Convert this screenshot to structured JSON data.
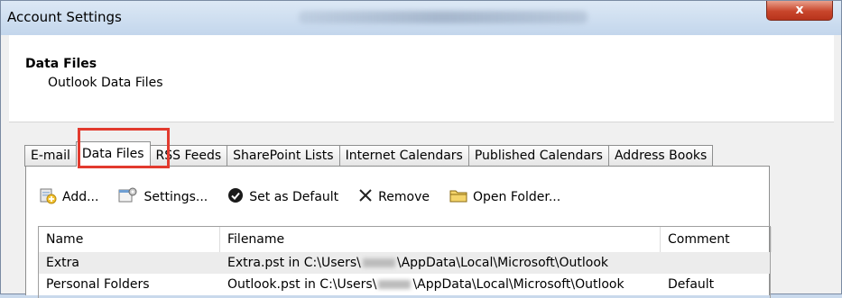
{
  "window": {
    "title": "Account Settings",
    "close_label": "x"
  },
  "header": {
    "title": "Data Files",
    "subtitle": "Outlook Data Files"
  },
  "tabs": [
    {
      "label": "E-mail"
    },
    {
      "label": "Data Files",
      "active": true
    },
    {
      "label": "RSS Feeds"
    },
    {
      "label": "SharePoint Lists"
    },
    {
      "label": "Internet Calendars"
    },
    {
      "label": "Published Calendars"
    },
    {
      "label": "Address Books"
    }
  ],
  "toolbar": {
    "add_label": "Add...",
    "settings_label": "Settings...",
    "set_default_label": "Set as Default",
    "remove_label": "Remove",
    "open_folder_label": "Open Folder..."
  },
  "list": {
    "columns": {
      "name": "Name",
      "filename": "Filename",
      "comment": "Comment"
    },
    "rows": [
      {
        "name": "Extra",
        "filename_prefix": "Extra.pst in C:\\Users\\",
        "filename_suffix": "\\AppData\\Local\\Microsoft\\Outlook",
        "comment": ""
      },
      {
        "name": "Personal Folders",
        "filename_prefix": "Outlook.pst in C:\\Users\\",
        "filename_suffix": "\\AppData\\Local\\Microsoft\\Outlook",
        "comment": "Default"
      }
    ]
  },
  "colors": {
    "highlight": "#e23a2e",
    "close_button": "#c8452b",
    "titlebar": "#c3d6ec"
  }
}
